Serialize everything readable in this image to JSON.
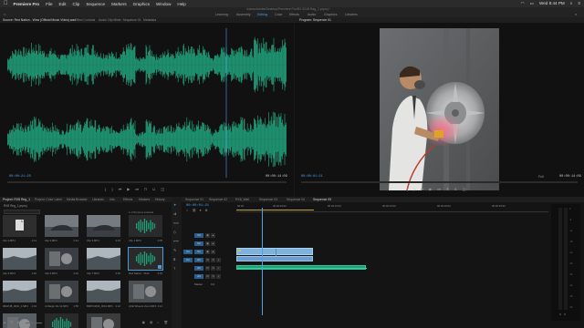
{
  "menubar": {
    "app_name": "Premiere Pro",
    "items": [
      "File",
      "Edit",
      "Clip",
      "Sequence",
      "Markers",
      "Graphics",
      "Window",
      "Help"
    ],
    "clock": "Wed 8:44 PM"
  },
  "title_path": "/Users/Adobe/Desktop/Premiere Pro/RX 2018 Rag_1.prproj *",
  "workspaces": [
    "Learning",
    "Assembly",
    "Editing",
    "Color",
    "Effects",
    "Audio",
    "Graphics",
    "Libraries"
  ],
  "active_workspace": "Editing",
  "source_panel": {
    "tabs": [
      "Source: Red Nation - Wow (Official Music Video).wav",
      "Effect Controls",
      "Audio Clip Mixer: Sequence 01",
      "Metadata"
    ],
    "timecode_in": "00:00:21:20",
    "timecode_out": "00:00:14:09"
  },
  "program_panel": {
    "tab": "Program: Sequence 01",
    "timecode_in": "00:00:01:21",
    "fit_label": "Full",
    "timecode_out": "00:00:14:09"
  },
  "project_panel": {
    "tabs": [
      "Project: RX8 Reg_1",
      "Project: Color Label",
      "Media Browser",
      "Libraries",
      "Info",
      "Effects",
      "Markers",
      "History"
    ],
    "project_file": "RX8 Reg_1.prproj",
    "count_label": "1 of 54 items selected",
    "items": [
      {
        "name": "Clip 4.MP4",
        "dur": "2:11"
      },
      {
        "name": "Clip 2.MP4",
        "dur": "3:14"
      },
      {
        "name": "Clip 3.MP4",
        "dur": "3:23"
      },
      {
        "name": "Clip 1.MP4",
        "dur": "4:05"
      },
      {
        "name": "Clip 6.MP4",
        "dur": "1:42"
      },
      {
        "name": "Clip 6.MP4",
        "dur": "2:10"
      },
      {
        "name": "Clip 7.MP4",
        "dur": "3:01"
      },
      {
        "name": "Red Nation - Wow",
        "dur": "3:22"
      },
      {
        "name": "IMGPJB_0001_1.MP4",
        "dur": "2:04"
      },
      {
        "name": "A Margin 0G 11.MP4",
        "dur": "1:55"
      },
      {
        "name": "BMPC0003_0001.MP4",
        "dur": "2:22"
      },
      {
        "name": "ACE Wheels shoot.MP4",
        "dur": "3:14"
      },
      {
        "name": "IMGPJB_0001_5.MP4",
        "dur": "1:22"
      },
      {
        "name": "Lake Park Rain Best",
        "dur": "0:55"
      },
      {
        "name": "IMGPJB_000_1.MP4",
        "dur": "2:21"
      }
    ]
  },
  "timeline_panel": {
    "tabs": [
      "Sequence 01",
      "Sequence 02",
      "RX8_Wall",
      "Sequence 03",
      "Sequence 04",
      "Sequence 05"
    ],
    "active_tab": "Sequence 05",
    "timecode": "00:00:01:21",
    "ruler": [
      "00:00",
      "00:00:05:00",
      "00:00:10:00",
      "00:00:15:00",
      "00:00:20:00",
      "00:00:25:00"
    ],
    "tracks": [
      "V3",
      "V2",
      "V1",
      "A1",
      "A2",
      "A3",
      "Master"
    ],
    "master_value": "0.0"
  },
  "colors": {
    "waveform": "#1f9e78",
    "accent": "#4a9bd6",
    "clip_video": "#7fb2dc",
    "clip_audio": "#1f9e78",
    "playhead": "#4aa3e8"
  }
}
